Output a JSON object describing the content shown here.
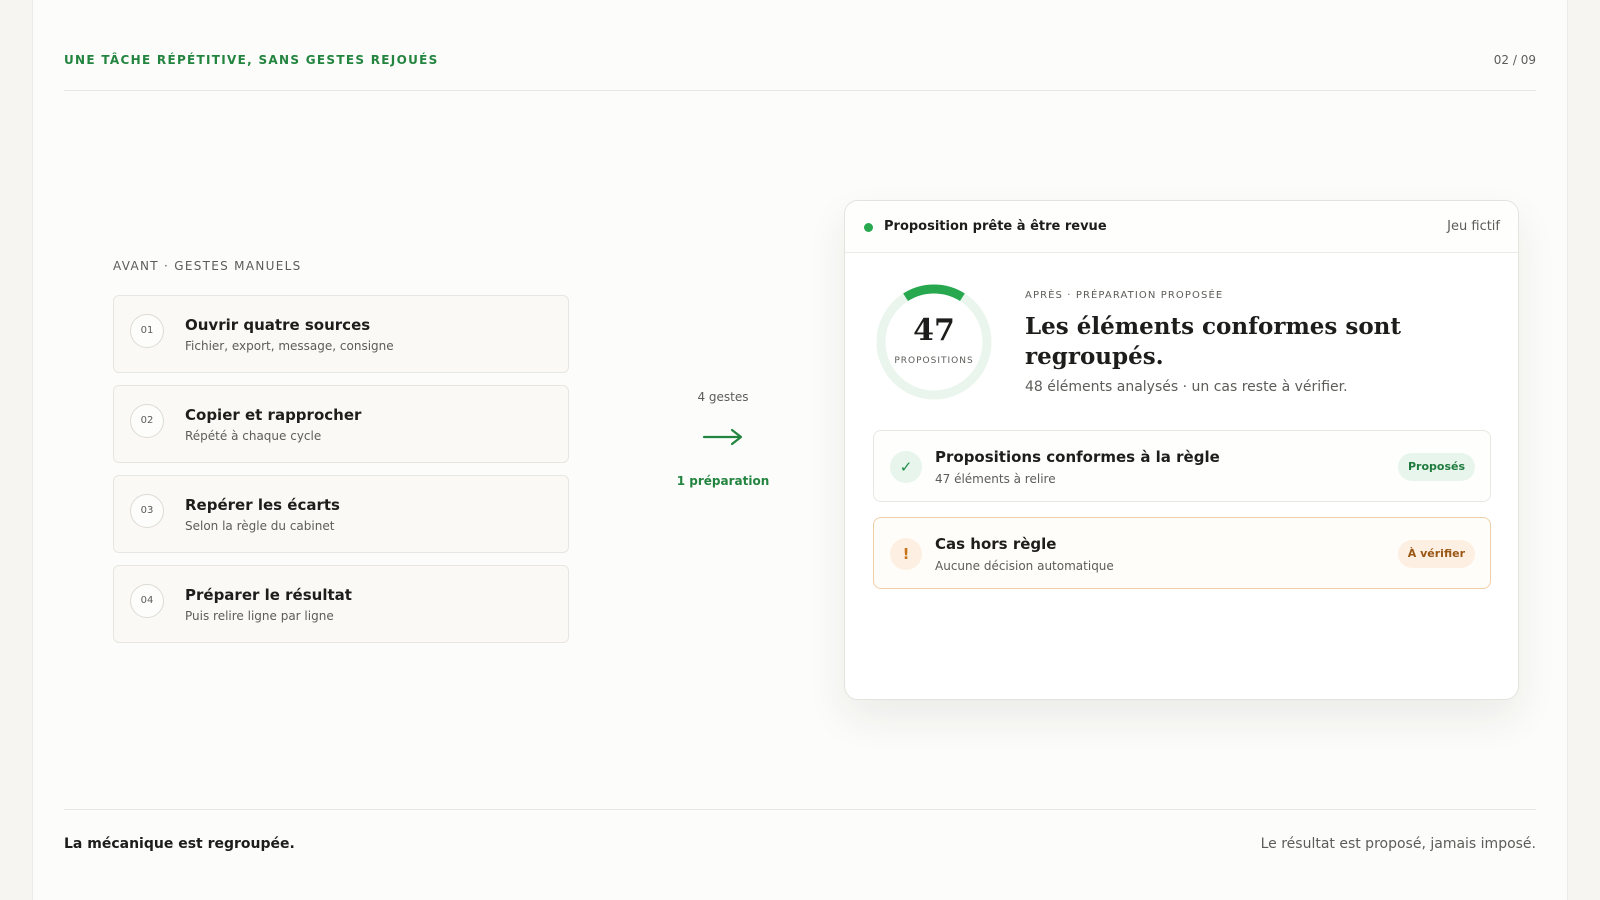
{
  "header": {
    "kicker": "UNE TÂCHE RÉPÉTITIVE, SANS GESTES REJOUÉS",
    "page_number": "02 / 09"
  },
  "before": {
    "label": "AVANT · GESTES MANUELS",
    "steps": [
      {
        "number": "01",
        "title": "Ouvrir quatre sources",
        "subtitle": "Fichier, export, message, consigne"
      },
      {
        "number": "02",
        "title": "Copier et rapprocher",
        "subtitle": "Répété à chaque cycle"
      },
      {
        "number": "03",
        "title": "Repérer les écarts",
        "subtitle": "Selon la règle du cabinet"
      },
      {
        "number": "04",
        "title": "Préparer le résultat",
        "subtitle": "Puis relire ligne par ligne"
      }
    ]
  },
  "transition": {
    "gestures": "4 gestes",
    "arrow_icon": "arrow-right-icon",
    "result": "1 préparation"
  },
  "panel": {
    "status_text": "Proposition prête à être revue",
    "tag": "Jeu fictif",
    "ring": {
      "value": "47",
      "label": "PROPOSITIONS",
      "fraction": 0.18
    },
    "after_label": "APRÈS · PRÉPARATION PROPOSÉE",
    "headline": "Les éléments conformes sont regroupés.",
    "summary": "48 éléments analysés · un cas reste à vérifier.",
    "rows": [
      {
        "icon": "✓",
        "title": "Propositions conformes à la règle",
        "subtitle": "47 éléments à relire",
        "badge": "Proposés"
      },
      {
        "icon": "!",
        "title": "Cas hors règle",
        "subtitle": "Aucune décision automatique",
        "badge": "À vérifier"
      }
    ]
  },
  "footer": {
    "left": "La mécanique est regroupée.",
    "right": "Le résultat est proposé, jamais imposé."
  },
  "colors": {
    "accent_green": "#23843f",
    "status_green": "#27a84f",
    "warning_orange": "#c7741a",
    "background": "#fcfcfa"
  }
}
